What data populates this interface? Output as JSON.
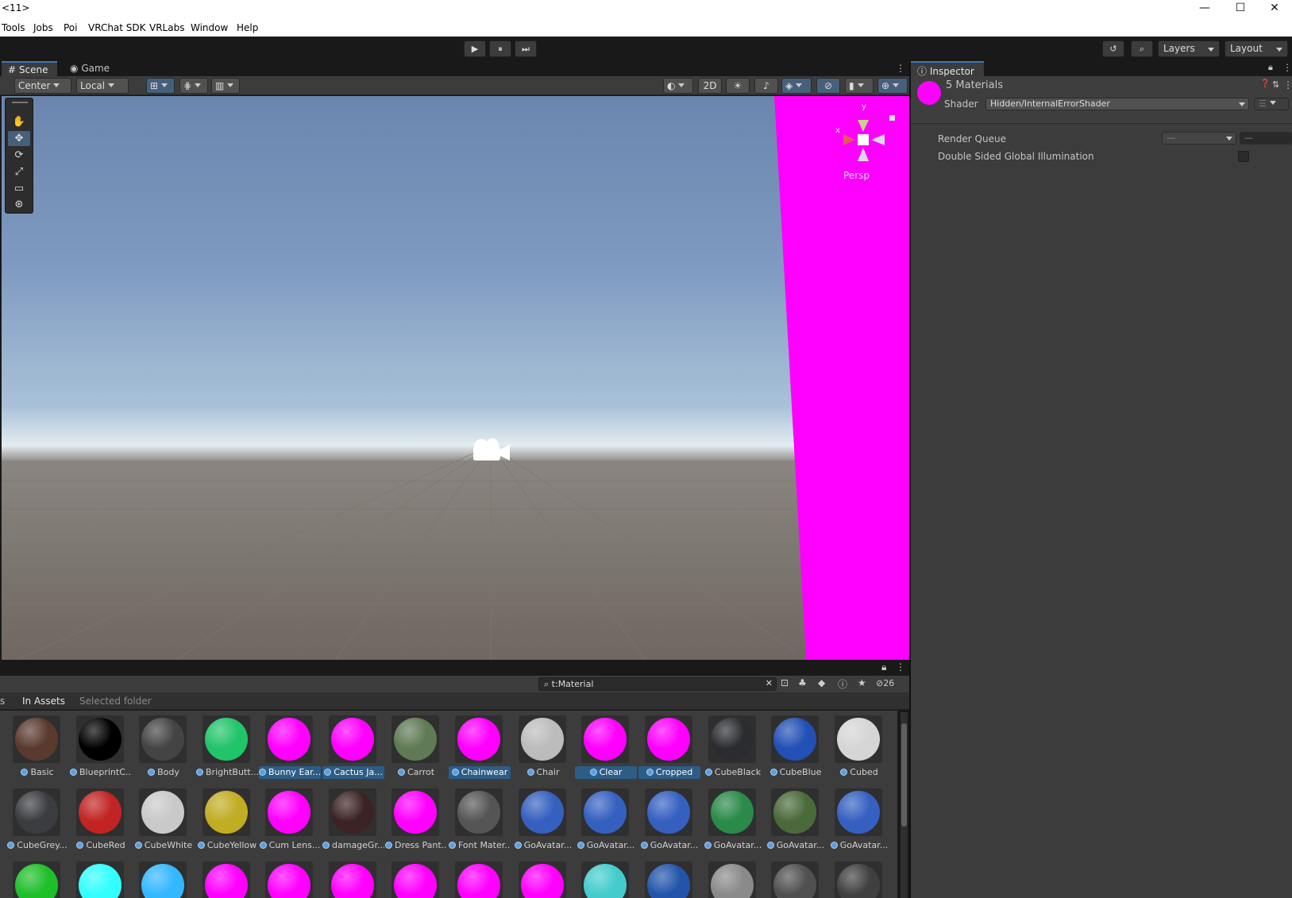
{
  "window": {
    "title": "<11>",
    "minimize": "—",
    "maximize": "☐",
    "close": "✕"
  },
  "menu": [
    "Tools",
    "Jobs",
    "Poi",
    "VRChat SDK",
    "VRLabs",
    "Window",
    "Help"
  ],
  "playbar": {
    "play": "▶",
    "pause": "⏸",
    "step": "⏭"
  },
  "toolbar_right": {
    "history_icon": "↺",
    "search_icon": "⌕",
    "layers": "Layers",
    "layout": "Layout"
  },
  "scene": {
    "tabs": [
      {
        "label": "Scene",
        "icon": "#"
      },
      {
        "label": "Game",
        "icon": "◉"
      }
    ],
    "pivot": "Center",
    "space": "Local",
    "mode_2d": "2D",
    "persp": "Persp",
    "gizmo_x": "x",
    "gizmo_y": "y"
  },
  "project": {
    "search": "t:Material",
    "count": "26",
    "filters": {
      "prefix": "s",
      "in_assets": "In Assets",
      "selected_folder": "Selected folder"
    },
    "assets": [
      {
        "name": "Basic",
        "color": "#5a3a2e",
        "selected": false
      },
      {
        "name": "BlueprintC...",
        "color": "#000000",
        "selected": false
      },
      {
        "name": "Body",
        "color": "#444444",
        "selected": false
      },
      {
        "name": "BrightButt...",
        "color": "#22c46a",
        "selected": false
      },
      {
        "name": "Bunny Ear...",
        "color": "#ff00ff",
        "selected": true
      },
      {
        "name": "Cactus Ja...",
        "color": "#ff00ff",
        "selected": true
      },
      {
        "name": "Carrot",
        "color": "#5f7a54",
        "selected": false
      },
      {
        "name": "Chainwear",
        "color": "#ff00ff",
        "selected": true
      },
      {
        "name": "Chair",
        "color": "#bcbcbc",
        "selected": false
      },
      {
        "name": "Clear",
        "color": "#ff00ff",
        "selected": true
      },
      {
        "name": "Cropped",
        "color": "#ff00ff",
        "selected": true
      },
      {
        "name": "CubeBlack",
        "color": "#2a2c30",
        "selected": false
      },
      {
        "name": "CubeBlue",
        "color": "#2350b5",
        "selected": false
      },
      {
        "name": "Cubed",
        "color": "#d5d5d5",
        "selected": false
      },
      {
        "name": "CubeGrey...",
        "color": "#3a3c40",
        "selected": false
      },
      {
        "name": "CubeRed",
        "color": "#c22323",
        "selected": false
      },
      {
        "name": "CubeWhite",
        "color": "#c9c9c9",
        "selected": false
      },
      {
        "name": "CubeYellow",
        "color": "#c0ad24",
        "selected": false
      },
      {
        "name": "Cum Lens...",
        "color": "#ff00ff",
        "selected": false
      },
      {
        "name": "damageGr...",
        "color": "#3c2323",
        "selected": false
      },
      {
        "name": "Dress Pant...",
        "color": "#ff00ff",
        "selected": false
      },
      {
        "name": "Font Mater...",
        "color": "#555555",
        "selected": false
      },
      {
        "name": "GoAvatar...",
        "color": "#3560c0",
        "selected": false
      },
      {
        "name": "GoAvatar...",
        "color": "#3560c0",
        "selected": false
      },
      {
        "name": "GoAvatar...",
        "color": "#3560c0",
        "selected": false
      },
      {
        "name": "GoAvatar...",
        "color": "#2a8a4a",
        "selected": false
      },
      {
        "name": "GoAvatar...",
        "color": "#4a6a3a",
        "selected": false
      },
      {
        "name": "GoAvatar...",
        "color": "#3560c0",
        "selected": false
      },
      {
        "name": "",
        "color": "#1fbf2a",
        "selected": false
      },
      {
        "name": "",
        "color": "#33ffff",
        "selected": false
      },
      {
        "name": "",
        "color": "#33b8ff",
        "selected": false
      },
      {
        "name": "",
        "color": "#ff00ff",
        "selected": false
      },
      {
        "name": "",
        "color": "#ff00ff",
        "selected": false
      },
      {
        "name": "",
        "color": "#ff00ff",
        "selected": false
      },
      {
        "name": "",
        "color": "#ff00ff",
        "selected": false
      },
      {
        "name": "",
        "color": "#ff00ff",
        "selected": false
      },
      {
        "name": "",
        "color": "#ff00ff",
        "selected": false
      },
      {
        "name": "",
        "color": "#44cccc",
        "selected": false
      },
      {
        "name": "",
        "color": "#2255aa",
        "selected": false
      },
      {
        "name": "",
        "color": "#8a8a8a",
        "selected": false
      },
      {
        "name": "",
        "color": "#505050",
        "selected": false
      },
      {
        "name": "",
        "color": "#404040",
        "selected": false
      }
    ]
  },
  "inspector": {
    "tab": "Inspector",
    "title": "5 Materials",
    "shader_label": "Shader",
    "shader_value": "Hidden/InternalErrorShader",
    "render_queue_label": "Render Queue",
    "render_queue_value": "—",
    "render_queue_number": "—",
    "dsgi_label": "Double Sided Global Illumination",
    "dsgi_checked": false,
    "material_color": "#ff00ff"
  }
}
